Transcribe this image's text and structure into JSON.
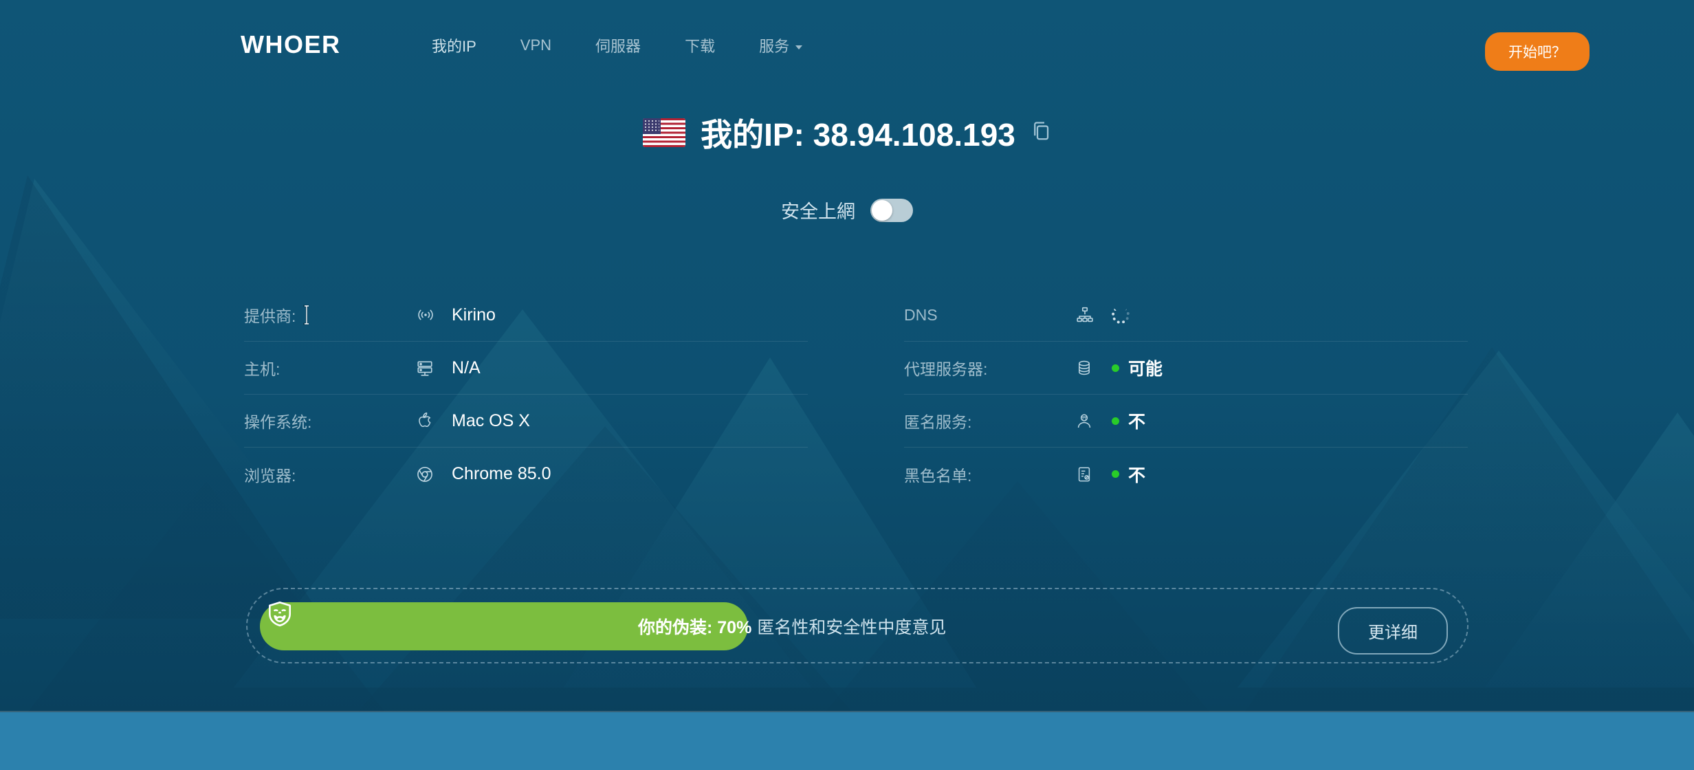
{
  "header": {
    "logo": "WHOER",
    "nav": [
      {
        "label": "我的IP",
        "name": "nav-my-ip"
      },
      {
        "label": "VPN",
        "name": "nav-vpn"
      },
      {
        "label": "伺服器",
        "name": "nav-servers"
      },
      {
        "label": "下载",
        "name": "nav-download"
      },
      {
        "label": "服务",
        "name": "nav-services",
        "has_caret": true
      }
    ],
    "cta_label": "开始吧？",
    "cta_color": "#ef7d18"
  },
  "hero": {
    "flag": "us-flag-icon",
    "ip_title": "我的IP: 38.94.108.193",
    "copy_icon": "copy-icon",
    "secure_label": "安全上網",
    "secure_toggle_state": "off"
  },
  "info": {
    "left": [
      {
        "label": "提供商:",
        "value": "Kirino",
        "icon": "signal-icon"
      },
      {
        "label": "主机:",
        "value": "N/A",
        "icon": "server-icon"
      },
      {
        "label": "操作系统:",
        "value": "Mac OS X",
        "icon": "apple-icon"
      },
      {
        "label": "浏览器:",
        "value": "Chrome 85.0",
        "icon": "chrome-icon"
      }
    ],
    "right": [
      {
        "label": "DNS",
        "value": "",
        "icon": "network-tree-icon",
        "status": "loading"
      },
      {
        "label": "代理服务器:",
        "value": "可能",
        "icon": "database-icon",
        "status": "ok",
        "dot_color": "#29cc29"
      },
      {
        "label": "匿名服务:",
        "value": "不",
        "icon": "anonymous-user-icon",
        "status": "ok",
        "dot_color": "#29cc29"
      },
      {
        "label": "黑色名单:",
        "value": "不",
        "icon": "blacklist-icon",
        "status": "ok",
        "dot_color": "#29cc29"
      }
    ]
  },
  "anonymity": {
    "mask_icon": "anonymous-mask-icon",
    "score_label": "你的伪装: 70%",
    "score_percent": 70,
    "description": "匿名性和安全性中度意见",
    "bar_color": "#7cbe3f",
    "more_button_label": "更详细"
  }
}
